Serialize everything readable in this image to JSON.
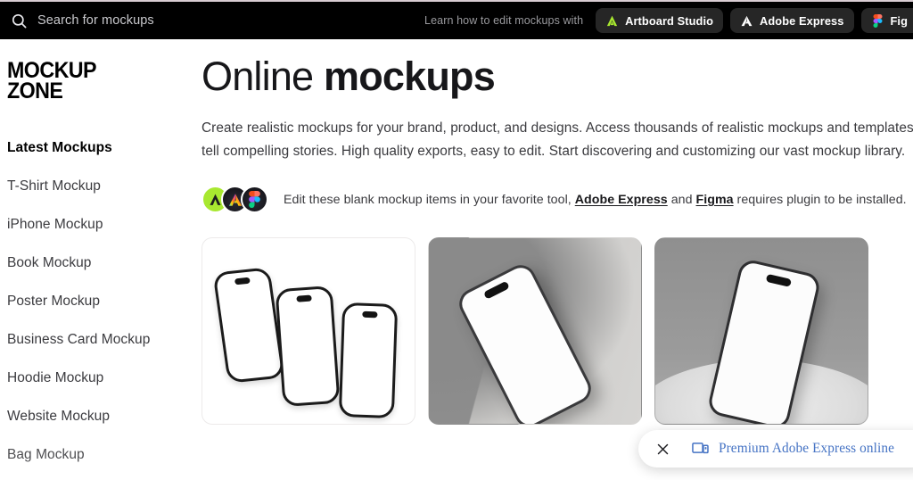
{
  "header": {
    "search": {
      "placeholder": "Search for mockups",
      "value": "",
      "icon": "search-icon"
    },
    "learn_label": "Learn how to edit mockups with",
    "buttons": [
      {
        "label": "Artboard Studio",
        "icon": "artboard-studio-logo-icon",
        "color": "#a8e830"
      },
      {
        "label": "Adobe Express",
        "icon": "adobe-express-logo-icon",
        "color": "#ffffff"
      },
      {
        "label": "Fig",
        "icon": "figma-logo-icon",
        "color": "#f24e1e"
      }
    ],
    "background": "#000000",
    "accent_line": "#d8ccd2"
  },
  "sidebar": {
    "logo_line1": "MOCKUP",
    "logo_line2": "ZONE",
    "items": [
      {
        "label": "Latest Mockups",
        "active": true
      },
      {
        "label": "T-Shirt Mockup",
        "active": false
      },
      {
        "label": "iPhone Mockup",
        "active": false
      },
      {
        "label": "Book Mockup",
        "active": false
      },
      {
        "label": "Poster Mockup",
        "active": false
      },
      {
        "label": "Business Card Mockup",
        "active": false
      },
      {
        "label": "Hoodie Mockup",
        "active": false
      },
      {
        "label": "Website Mockup",
        "active": false
      },
      {
        "label": "Bag Mockup",
        "active": false
      }
    ]
  },
  "main": {
    "title_regular": "Online ",
    "title_bold": "mockups",
    "intro": "Create realistic mockups for your brand, product, and designs. Access thousands of realistic mockups and templates to tell compelling stories. High quality exports, easy to edit. Start discovering and customizing our vast mockup library.",
    "edit_row": {
      "avatars": [
        "artboard-studio-avatar",
        "adobe-express-avatar",
        "figma-avatar"
      ],
      "prefix": "Edit these blank mockup items in your favorite tool, ",
      "link1": "Adobe Express",
      "middle": " and ",
      "link2": "Figma",
      "suffix": " requires plugin to be installed."
    },
    "cards": [
      {
        "name": "three-phones-white-mockup"
      },
      {
        "name": "phone-grey-flatlay-mockup"
      },
      {
        "name": "phone-grey-pedestal-mockup"
      }
    ]
  },
  "toast": {
    "close_icon": "close-icon",
    "device_icon": "device-screens-icon",
    "text": "Premium Adobe Express online",
    "text_color": "#4573c4"
  }
}
